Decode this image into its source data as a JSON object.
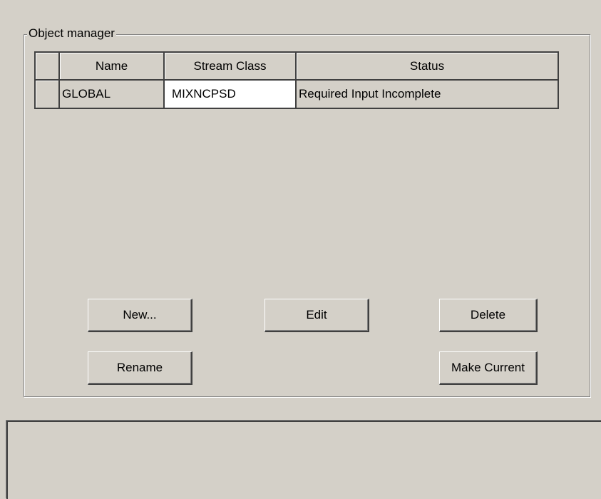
{
  "object_manager": {
    "title": "Object manager",
    "columns": [
      "Name",
      "Stream Class",
      "Status"
    ],
    "rows": [
      {
        "name": "GLOBAL",
        "stream_class": "MIXNCPSD",
        "status": "Required Input Incomplete"
      }
    ]
  },
  "buttons": {
    "new": "New...",
    "edit": "Edit",
    "delete": "Delete",
    "rename": "Rename",
    "make_current": "Make Current"
  },
  "colors": {
    "background": "#d4d0c8",
    "active_cell": "#ffffff",
    "border_dark": "#404040"
  }
}
